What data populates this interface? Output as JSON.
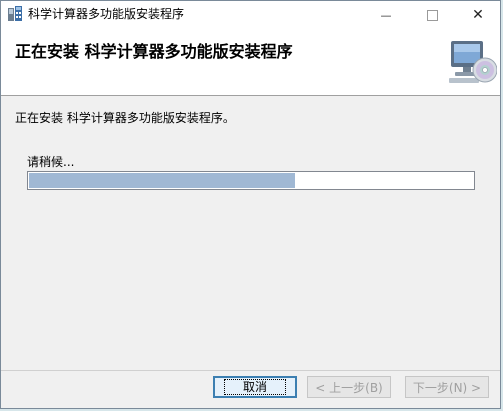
{
  "window": {
    "title": "科学计算器多功能版安装程序",
    "controls": {
      "minimize": "—",
      "close": "✕"
    }
  },
  "banner": {
    "title": "正在安装 科学计算器多功能版安装程序"
  },
  "main": {
    "status_text": "正在安装 科学计算器多功能版安装程序。",
    "wait_text": "请稍候...",
    "progress": 0.6
  },
  "buttons": {
    "cancel": "取消",
    "back": "< 上一步(B)",
    "next": "下一步(N) >"
  },
  "colors": {
    "progress_fill": "#a0b8d4",
    "title_bar": "#ffffff",
    "background": "#f0f0f0"
  }
}
